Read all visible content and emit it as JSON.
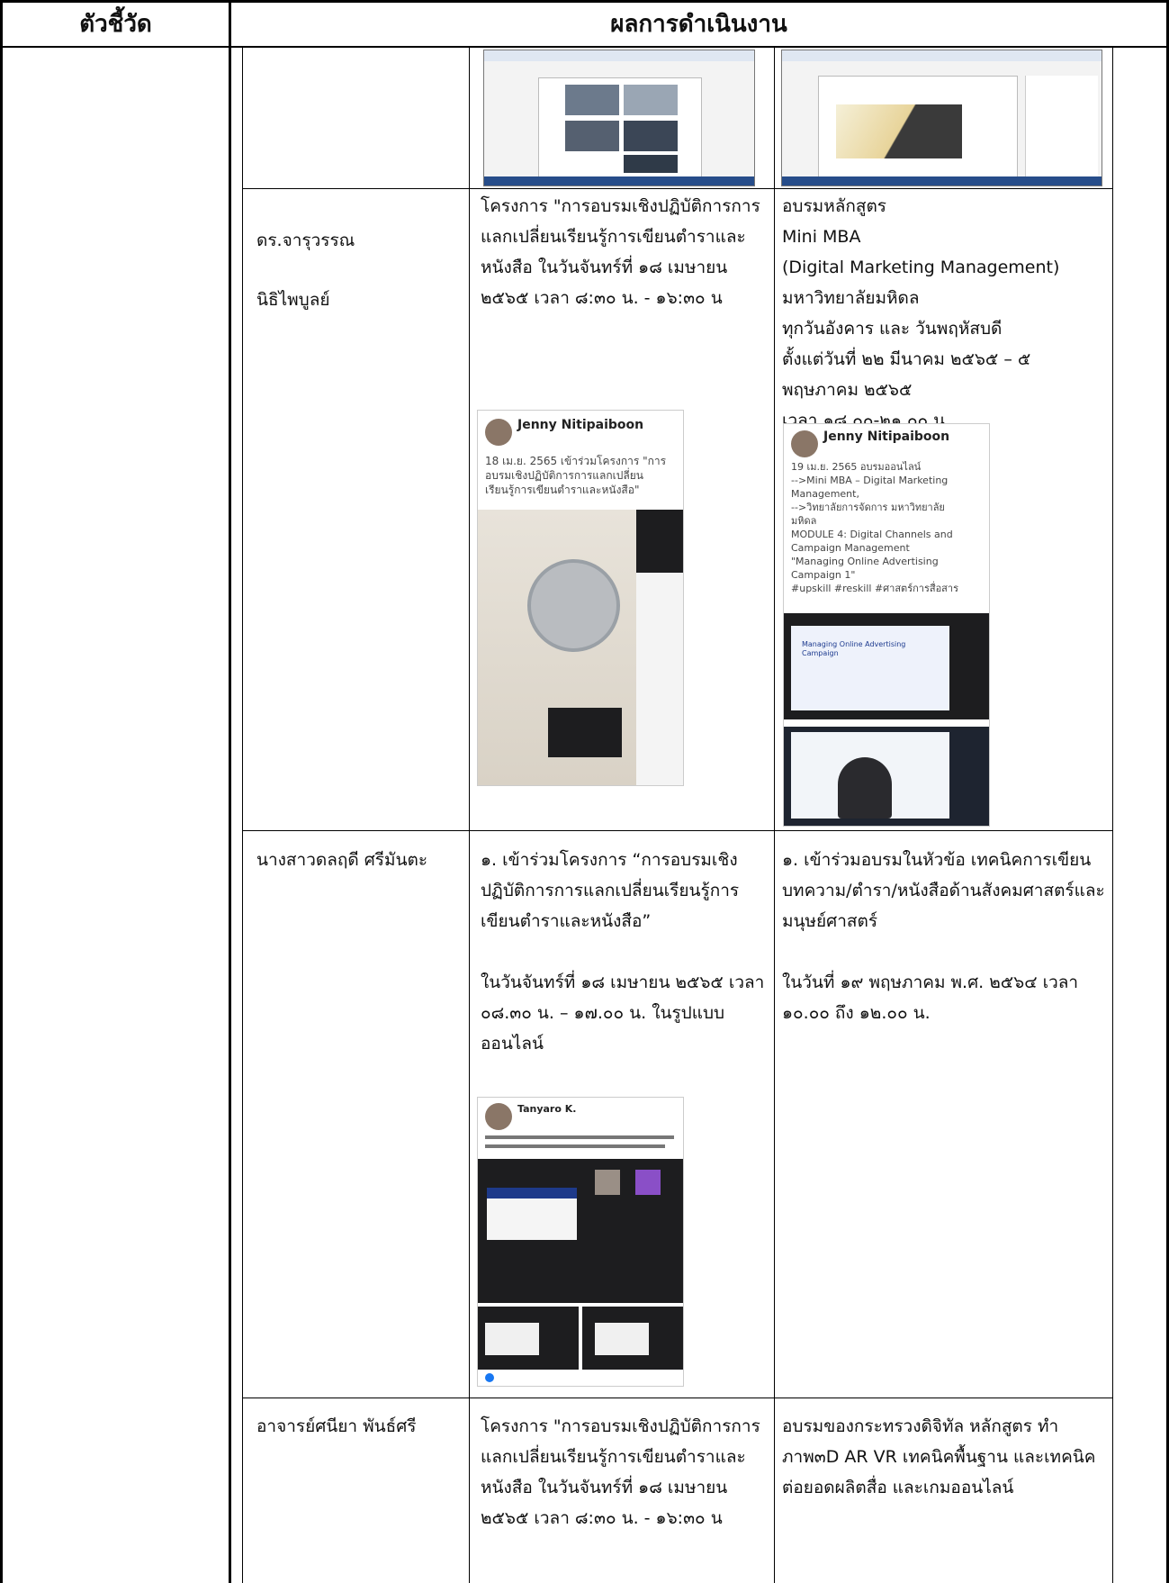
{
  "header": {
    "col1": "ตัวชี้วัด",
    "col2": "ผลการดำเนินงาน"
  },
  "rows": [
    {
      "name_line1": "ดร.จารุวรรณ",
      "name_line2": "นิธิไพบูลย์",
      "left_text": " โครงการ \"การอบรมเชิงปฏิบัติการการ\nแลกเปลี่ยนเรียนรู้การเขียนตำราและ\nหนังสือ ในวันจันทร์ที่ ๑๘ เมษายน\n๒๕๖๕ เวลา ๘:๓๐ น. - ๑๖:๓๐ น",
      "right_text": " อบรมหลักสูตร\nMini MBA\n(Digital Marketing Management)\nมหาวิทยาลัยมหิดล\nทุกวันอังคาร และ วันพฤหัสบดี\nตั้งแต่วันที่  ๒๒ มีนาคม ๒๕๖๕  – ๕\nพฤษภาคม ๒๕๖๕\nเวลา ๑๘.๐๐-๒๑.๐๐ น.",
      "left_post": {
        "author": "Jenny Nitipaiboon",
        "text": "18 เม.ย. 2565 เข้าร่วมโครงการ \"การ\nอบรมเชิงปฏิบัติการการแลกเปลี่ยน\nเรียนรู้การเขียนตำราและหนังสือ\""
      },
      "right_post": {
        "author": "Jenny Nitipaiboon",
        "text": "19 เม.ย. 2565 อบรมออนไลน์\n-->Mini MBA – Digital Marketing\nManagement,\n-->วิทยาลัยการจัดการ มหาวิทยาลัย\nมหิดล\n MODULE 4: Digital Channels and\nCampaign Management\n\"Managing Online Advertising\nCampaign 1\"\n#upskill #reskill #ศาสตร์การสื่อสาร",
        "slide_title": "Managing Online Advertising Campaign"
      }
    },
    {
      "name": "นางสาวดลฤดี ศรีมันตะ",
      "left_text": " ๑. เข้าร่วมโครงการ “การอบรมเชิง\nปฏิบัติการการแลกเปลี่ยนเรียนรู้การ\nเขียนตำราและหนังสือ”\n\nในวันจันทร์ที่ ๑๘ เมษายน ๒๕๖๕ เวลา\n๐๘.๓๐ น. – ๑๗.๐๐ น.  ในรูปแบบ\nออนไลน์",
      "right_text": " ๑. เข้าร่วมอบรมในหัวข้อ เทคนิคการเขียน\nบทความ/ตำรา/หนังสือด้านสังคมศาสตร์และ\nมนุษย์ศาสตร์\n\nในวันที่ ๑๙ พฤษภาคม พ.ศ. ๒๕๖๔ เวลา\n๑๐.๐๐ ถึง ๑๒.๐๐ น.",
      "left_post": {
        "author": "Tanyaro K."
      }
    },
    {
      "name": "อาจารย์ศนียา พันธ์ศรี",
      "left_text": " โครงการ \"การอบรมเชิงปฏิบัติการการ\nแลกเปลี่ยนเรียนรู้การเขียนตำราและ\nหนังสือ ในวันจันทร์ที่ ๑๘ เมษายน\n๒๕๖๕ เวลา ๘:๓๐ น. - ๑๖:๓๐ น",
      "right_text": " อบรมของกระทรวงดิจิทัล หลักสูตร ทำ\nภาพ๓D AR VR เทคนิคพื้นฐาน และเทคนิค\nต่อยอดผลิตสื่อ และเกมออนไลน์"
    }
  ]
}
